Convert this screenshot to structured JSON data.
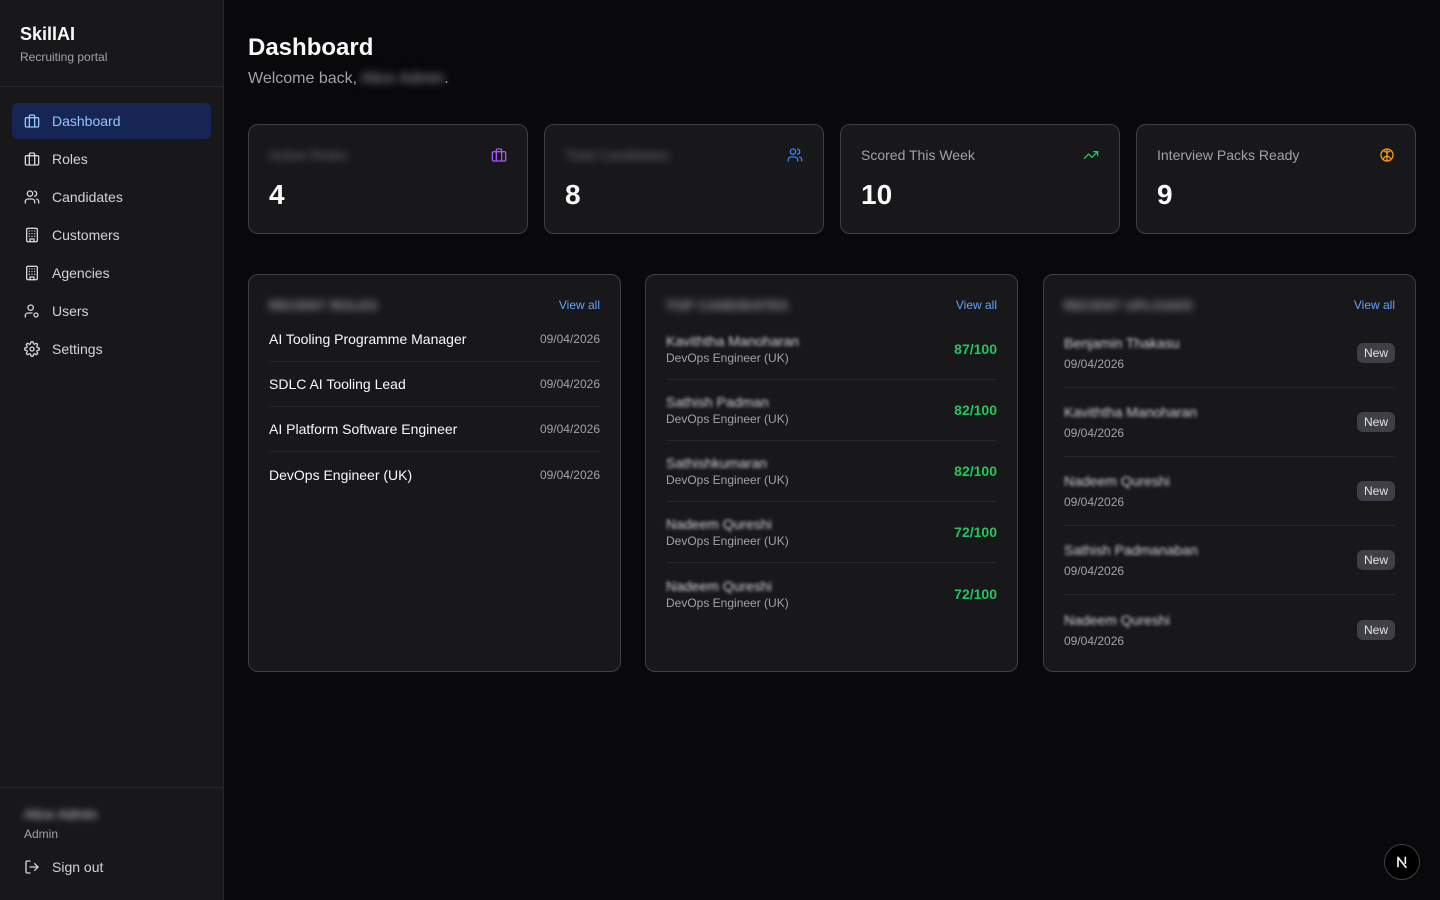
{
  "brand": {
    "name": "SkillAI",
    "subtitle": "Recruiting portal"
  },
  "sidebar": {
    "items": [
      {
        "label": "Dashboard",
        "icon": "briefcase-icon",
        "active": true
      },
      {
        "label": "Roles",
        "icon": "briefcase-icon"
      },
      {
        "label": "Candidates",
        "icon": "users-icon"
      },
      {
        "label": "Customers",
        "icon": "building-icon"
      },
      {
        "label": "Agencies",
        "icon": "building-icon"
      },
      {
        "label": "Users",
        "icon": "user-cog-icon"
      },
      {
        "label": "Settings",
        "icon": "gear-icon"
      }
    ],
    "user": {
      "name": "Alice Admin",
      "role": "Admin"
    },
    "signout_label": "Sign out"
  },
  "header": {
    "title": "Dashboard",
    "welcome_prefix": "Welcome back, ",
    "welcome_name": "Alice Admin",
    "welcome_suffix": "."
  },
  "stats": [
    {
      "label": "Active Roles",
      "value": "4",
      "icon": "briefcase-icon",
      "color": "#a855f7"
    },
    {
      "label": "Total Candidates",
      "value": "8",
      "icon": "users-icon",
      "color": "#3b82f6"
    },
    {
      "label": "Scored This Week",
      "value": "10",
      "icon": "trending-up-icon",
      "color": "#22c55e"
    },
    {
      "label": "Interview Packs Ready",
      "value": "9",
      "icon": "brain-icon",
      "color": "#f59e0b"
    }
  ],
  "panels": {
    "roles": {
      "title": "RECENT ROLES",
      "view_all": "View all",
      "items": [
        {
          "name": "AI Tooling Programme Manager",
          "date": "09/04/2026"
        },
        {
          "name": "SDLC AI Tooling Lead",
          "date": "09/04/2026"
        },
        {
          "name": "AI Platform Software Engineer",
          "date": "09/04/2026"
        },
        {
          "name": "DevOps Engineer (UK)",
          "date": "09/04/2026"
        }
      ]
    },
    "candidates": {
      "title": "TOP CANDIDATES",
      "view_all": "View all",
      "items": [
        {
          "name": "Kaviththa Manoharan",
          "role": "DevOps Engineer (UK)",
          "score": "87/100"
        },
        {
          "name": "Sathish Padman",
          "role": "DevOps Engineer (UK)",
          "score": "82/100"
        },
        {
          "name": "Sathishkumaran",
          "role": "DevOps Engineer (UK)",
          "score": "82/100"
        },
        {
          "name": "Nadeem Qureshi",
          "role": "DevOps Engineer (UK)",
          "score": "72/100"
        },
        {
          "name": "Nadeem Qureshi",
          "role": "DevOps Engineer (UK)",
          "score": "72/100"
        }
      ]
    },
    "uploads": {
      "title": "RECENT UPLOADS",
      "view_all": "View all",
      "items": [
        {
          "name": "Benjamin Thakasu",
          "date": "09/04/2026",
          "badge": "New"
        },
        {
          "name": "Kaviththa Manoharan",
          "date": "09/04/2026",
          "badge": "New"
        },
        {
          "name": "Nadeem Qureshi",
          "date": "09/04/2026",
          "badge": "New"
        },
        {
          "name": "Sathish Padmanaban",
          "date": "09/04/2026",
          "badge": "New"
        },
        {
          "name": "Nadeem Qureshi",
          "date": "09/04/2026",
          "badge": "New"
        }
      ]
    }
  },
  "colors": {
    "background": "#09090b",
    "surface": "#18181b",
    "border": "#3f3f46",
    "accent": "#60a5fa",
    "active_nav_bg": "#172554",
    "score": "#22c55e"
  },
  "floating_button": {
    "icon": "next-logo-icon"
  }
}
